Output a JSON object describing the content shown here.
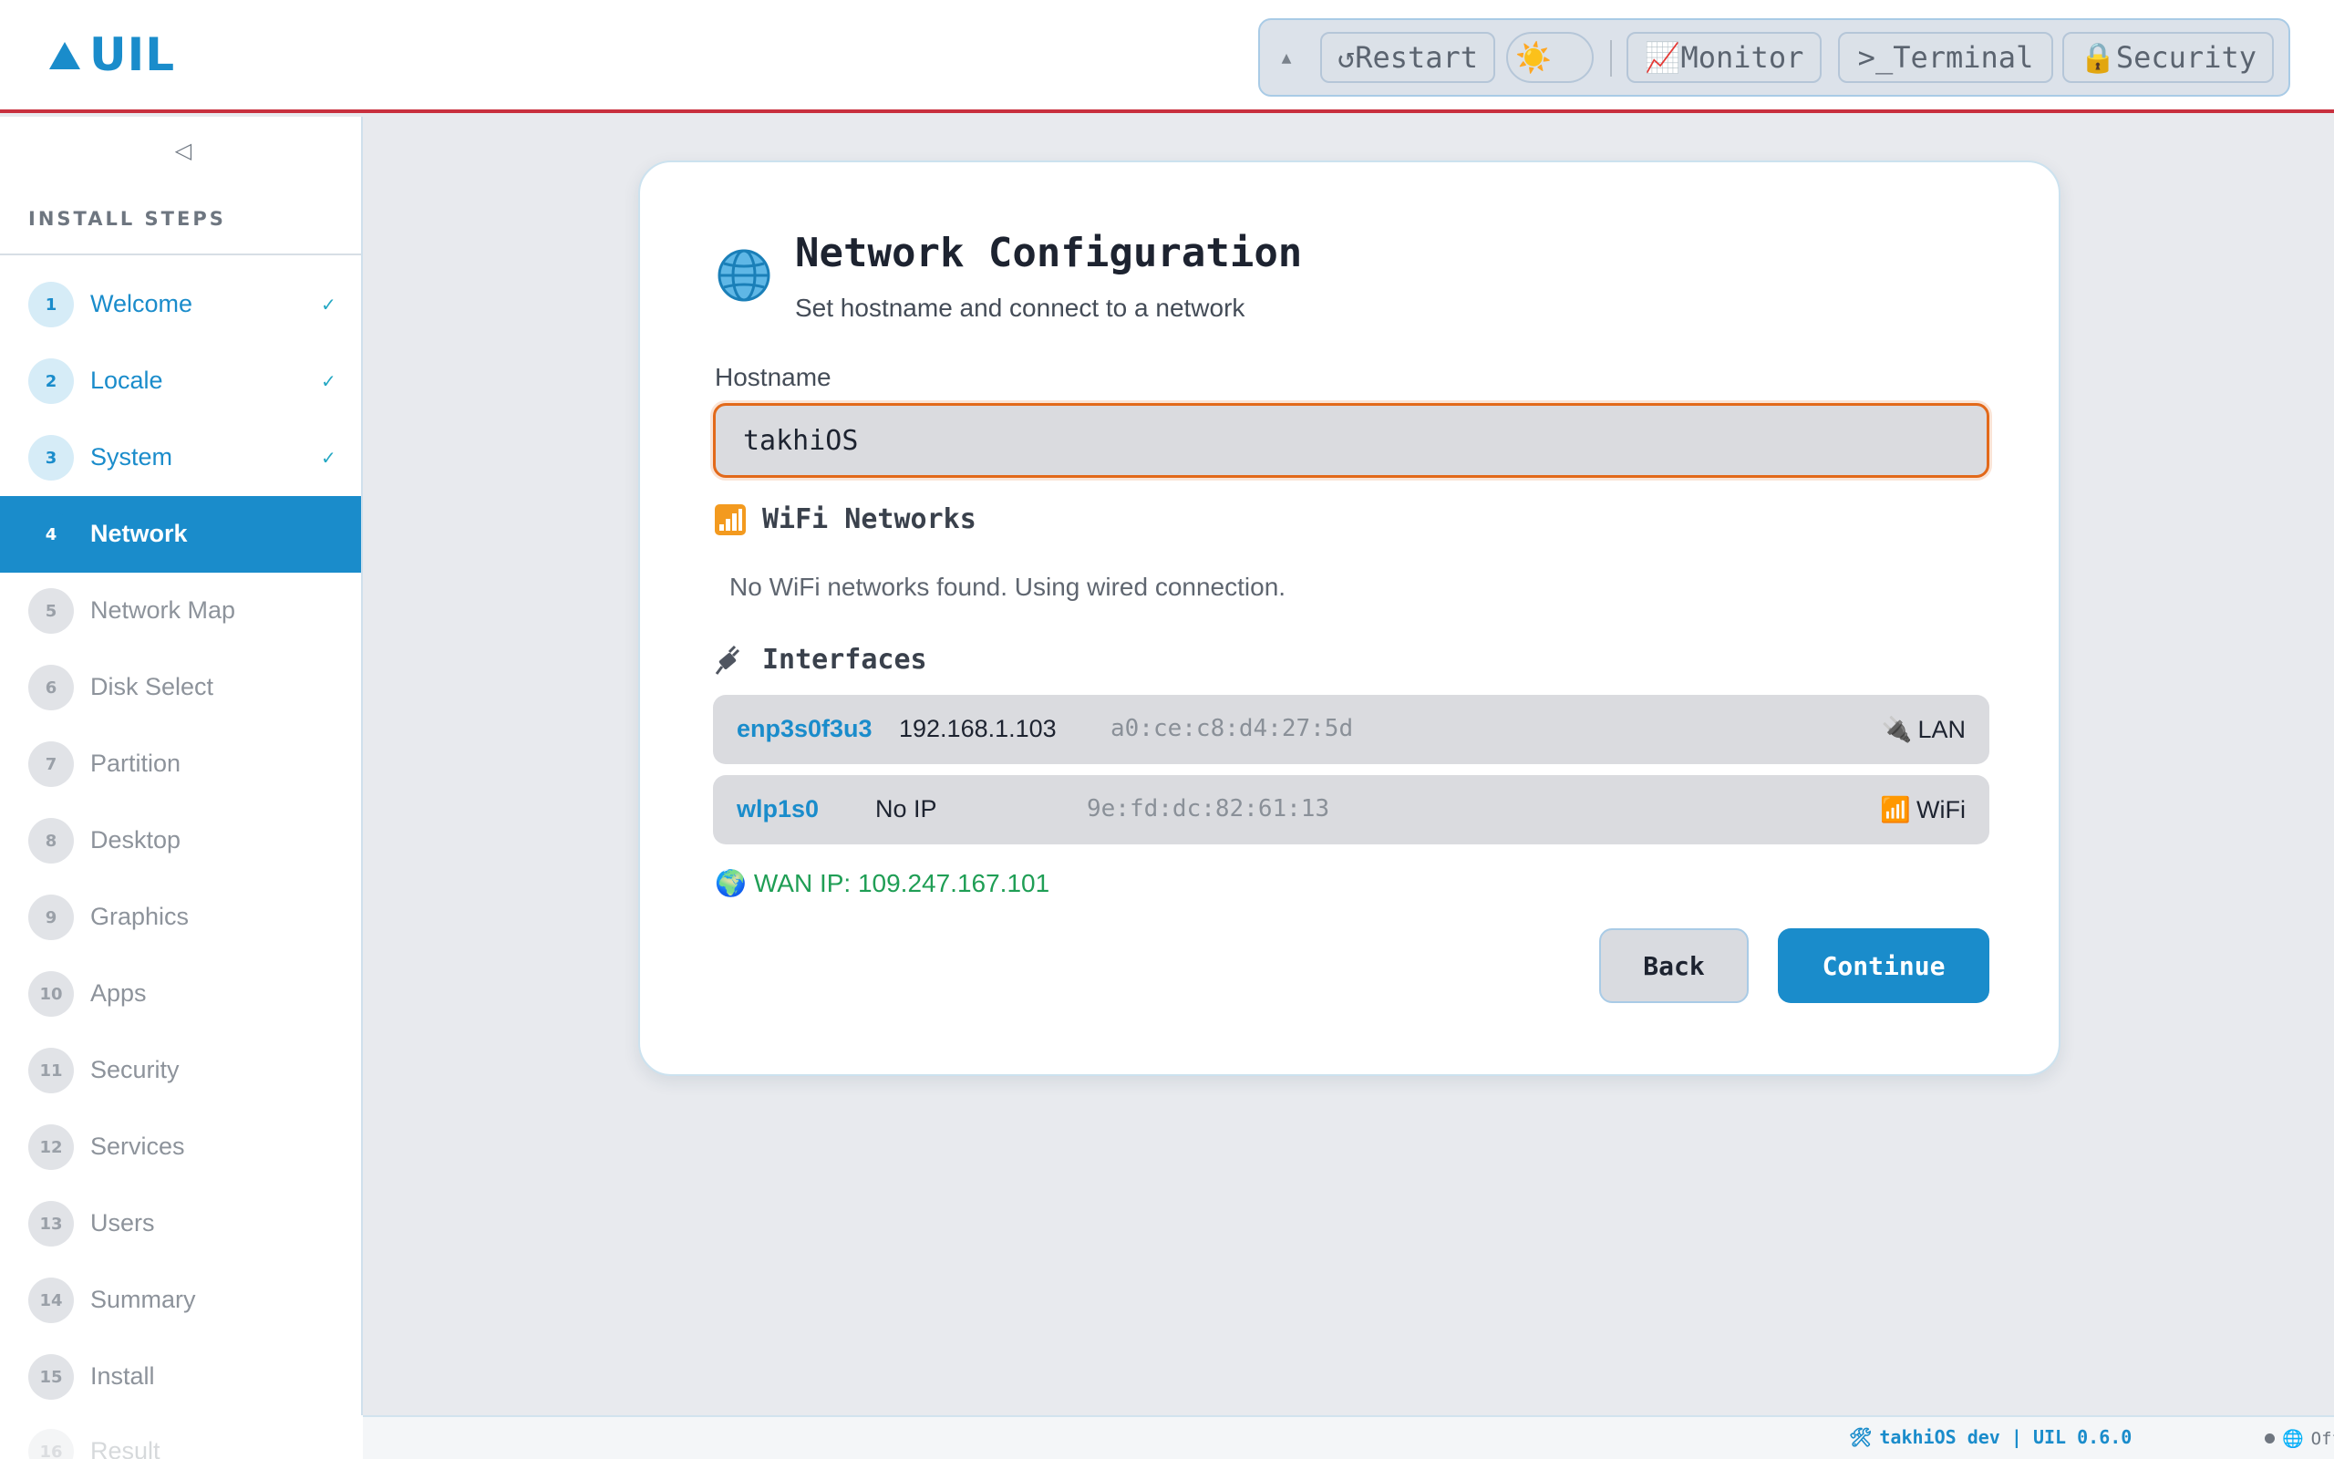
{
  "app": {
    "brand": "UIL"
  },
  "toolbar": {
    "collapse_glyph": "▲",
    "restart_label": "↺Restart",
    "theme_glyph": "☀️",
    "monitor_label": "📈Monitor",
    "terminal_label": ">_Terminal",
    "security_label": "🔒Security"
  },
  "sidebar": {
    "collapse_glyph": "◁",
    "heading": "INSTALL STEPS",
    "steps": [
      {
        "num": "1",
        "label": "Welcome",
        "state": "done",
        "check": "✓"
      },
      {
        "num": "2",
        "label": "Locale",
        "state": "done",
        "check": "✓"
      },
      {
        "num": "3",
        "label": "System",
        "state": "done",
        "check": "✓"
      },
      {
        "num": "4",
        "label": "Network",
        "state": "active",
        "check": ""
      },
      {
        "num": "5",
        "label": "Network Map",
        "state": "pending",
        "check": ""
      },
      {
        "num": "6",
        "label": "Disk Select",
        "state": "pending",
        "check": ""
      },
      {
        "num": "7",
        "label": "Partition",
        "state": "pending",
        "check": ""
      },
      {
        "num": "8",
        "label": "Desktop",
        "state": "pending",
        "check": ""
      },
      {
        "num": "9",
        "label": "Graphics",
        "state": "pending",
        "check": ""
      },
      {
        "num": "10",
        "label": "Apps",
        "state": "pending",
        "check": ""
      },
      {
        "num": "11",
        "label": "Security",
        "state": "pending",
        "check": ""
      },
      {
        "num": "12",
        "label": "Services",
        "state": "pending",
        "check": ""
      },
      {
        "num": "13",
        "label": "Users",
        "state": "pending",
        "check": ""
      },
      {
        "num": "14",
        "label": "Summary",
        "state": "pending",
        "check": ""
      },
      {
        "num": "15",
        "label": "Install",
        "state": "pending",
        "check": ""
      },
      {
        "num": "16",
        "label": "Result",
        "state": "pending",
        "check": ""
      }
    ]
  },
  "card": {
    "title": "Network Configuration",
    "subtitle": "Set hostname and connect to a network",
    "hostname": {
      "label": "Hostname",
      "value": "takhiOS"
    },
    "wifi": {
      "title": "WiFi Networks",
      "empty_message": "No WiFi networks found. Using wired connection."
    },
    "interfaces": {
      "title": "Interfaces",
      "rows": [
        {
          "name": "enp3s0f3u3",
          "ip": "192.168.1.103",
          "mac": "a0:ce:c8:d4:27:5d",
          "type_icon": "🔌",
          "type": "LAN"
        },
        {
          "name": "wlp1s0",
          "ip": "No IP",
          "mac": "9e:fd:dc:82:61:13",
          "type_icon": "📶",
          "type": "WiFi"
        }
      ]
    },
    "wan": {
      "icon": "🌍",
      "text": "WAN IP: 109.247.167.101"
    },
    "back_label": "Back",
    "continue_label": "Continue"
  },
  "footer": {
    "dev_icon": "🛠",
    "dev_text": "takhiOS dev | UIL 0.6.0",
    "status_icon": "🌐",
    "status_text": "Offline"
  },
  "colors": {
    "accent": "#1a8ccb",
    "topbar_rule": "#c8303e",
    "input_focus": "#e2691a",
    "wan_green": "#1f9e55"
  }
}
